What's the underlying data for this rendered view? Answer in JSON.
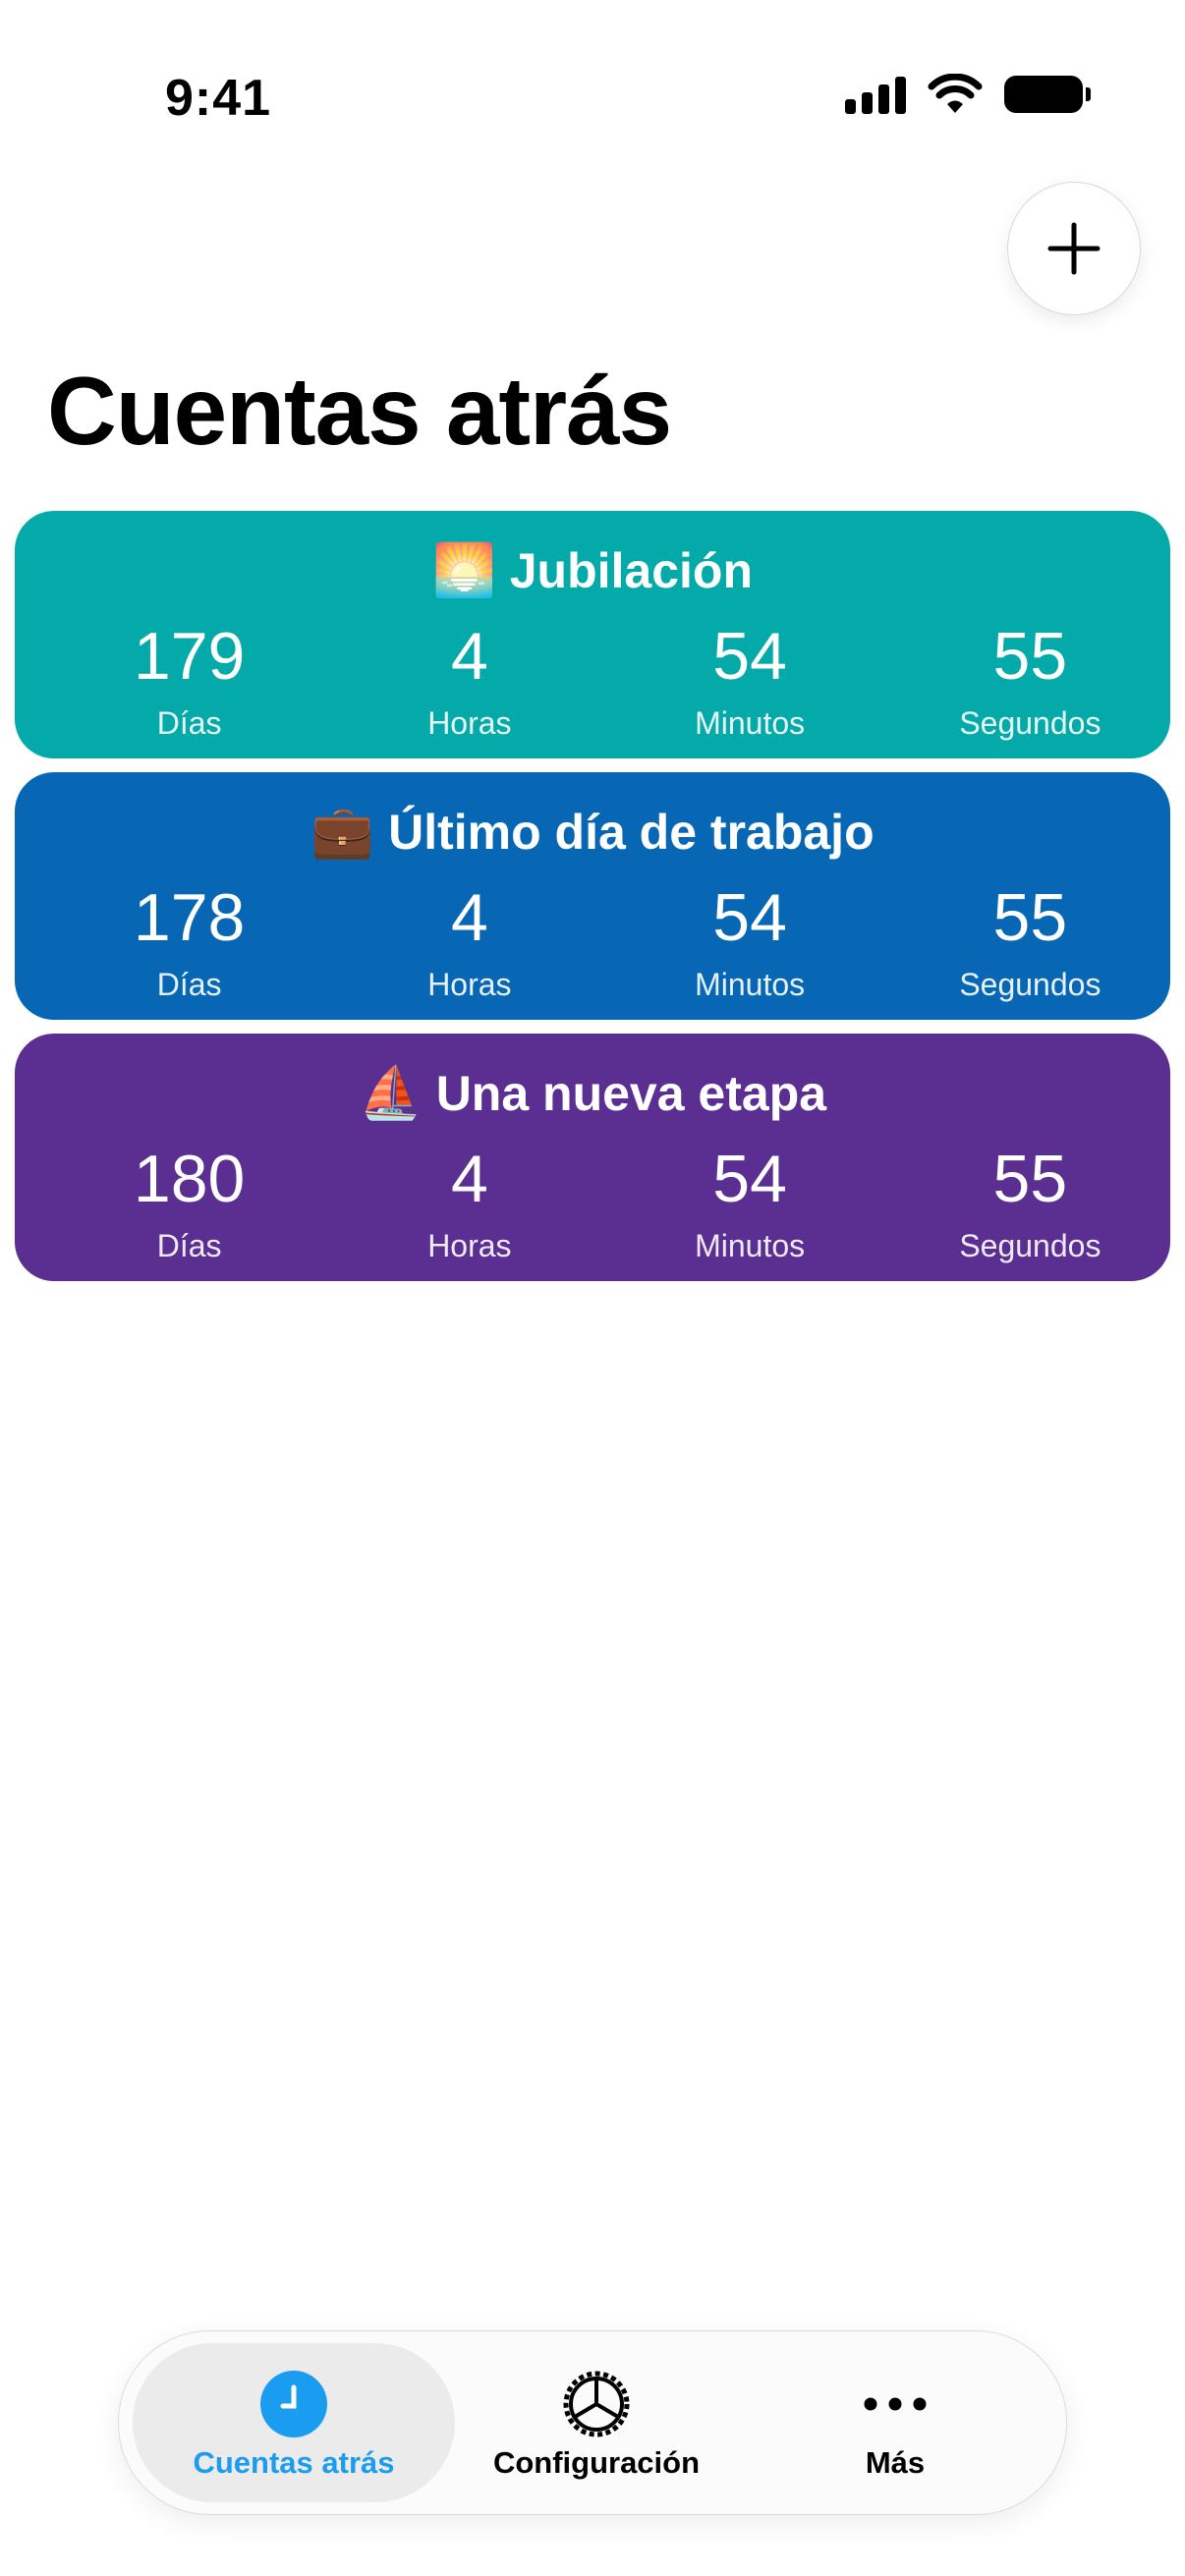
{
  "status_bar": {
    "time": "9:41"
  },
  "header": {
    "title": "Cuentas atrás",
    "add_icon": "plus-icon"
  },
  "cards": [
    {
      "emoji": "🌅",
      "title": "Jubilación",
      "color": "#04AAA9",
      "units": [
        {
          "value": "179",
          "label": "Días"
        },
        {
          "value": "4",
          "label": "Horas"
        },
        {
          "value": "54",
          "label": "Minutos"
        },
        {
          "value": "55",
          "label": "Segundos"
        }
      ]
    },
    {
      "emoji": "💼",
      "title": "Último día de trabajo",
      "color": "#0767B4",
      "units": [
        {
          "value": "178",
          "label": "Días"
        },
        {
          "value": "4",
          "label": "Horas"
        },
        {
          "value": "54",
          "label": "Minutos"
        },
        {
          "value": "55",
          "label": "Segundos"
        }
      ]
    },
    {
      "emoji": "⛵",
      "title": "Una nueva etapa",
      "color": "#5A2F91",
      "units": [
        {
          "value": "180",
          "label": "Días"
        },
        {
          "value": "4",
          "label": "Horas"
        },
        {
          "value": "54",
          "label": "Minutos"
        },
        {
          "value": "55",
          "label": "Segundos"
        }
      ]
    }
  ],
  "tab_bar": {
    "accent_color": "#1A9CF0",
    "tabs": [
      {
        "label": "Cuentas atrás",
        "icon": "clock-icon",
        "selected": true
      },
      {
        "label": "Configuración",
        "icon": "gear-icon",
        "selected": false
      },
      {
        "label": "Más",
        "icon": "more-icon",
        "selected": false
      }
    ]
  }
}
